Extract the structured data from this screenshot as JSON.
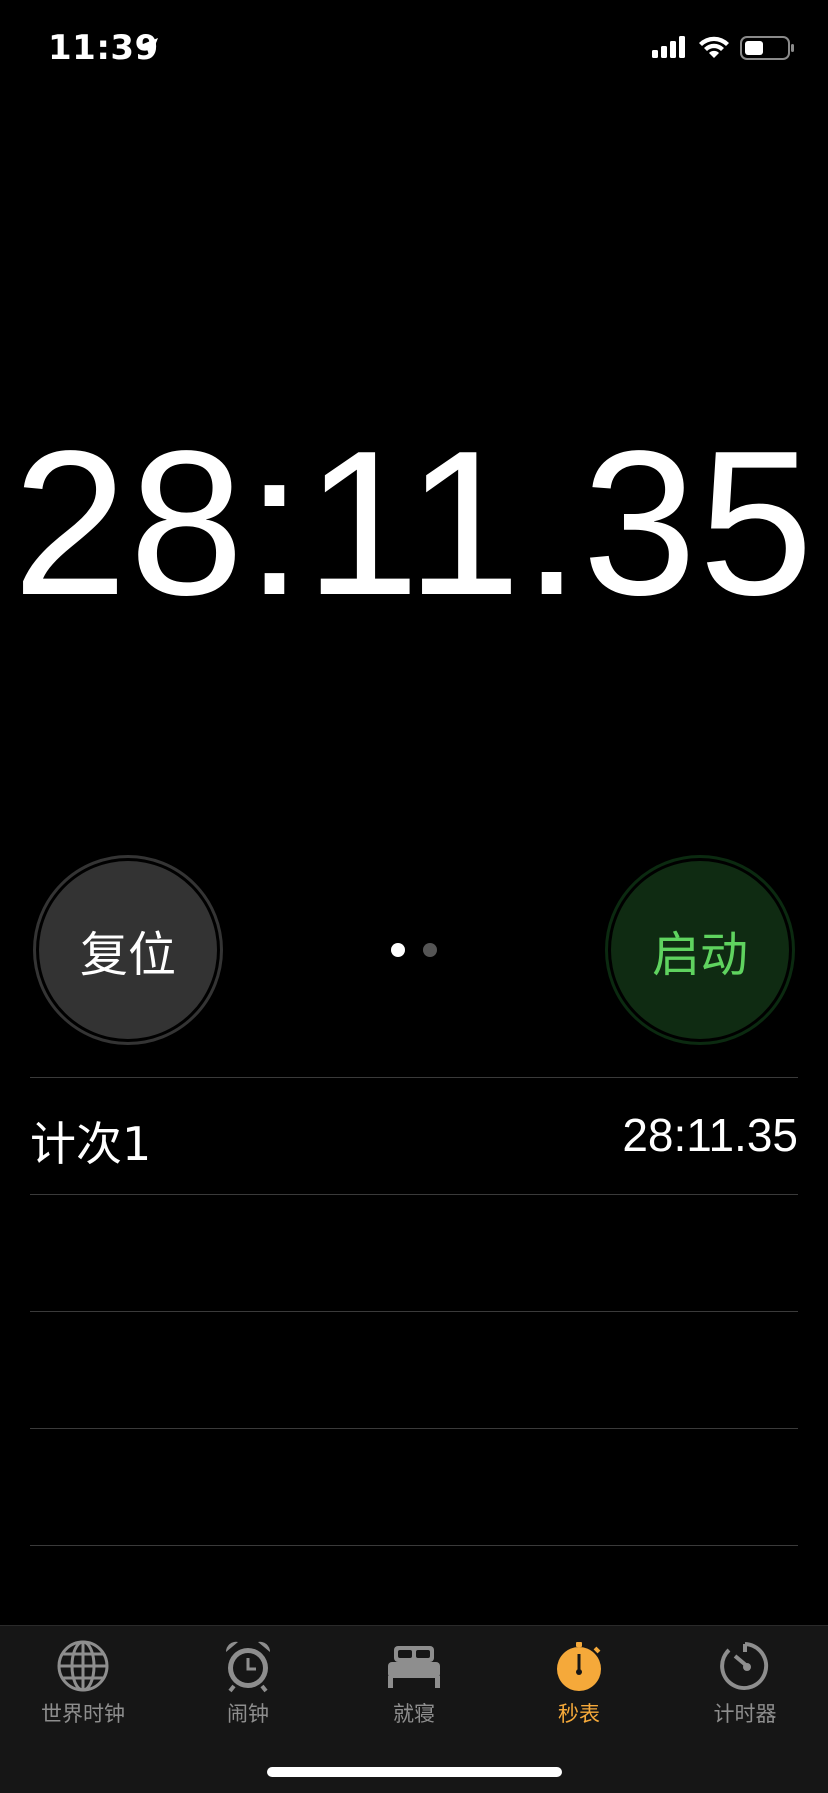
{
  "status_bar": {
    "time": "11:39"
  },
  "stopwatch": {
    "elapsed": "28:11.35",
    "reset_label": "复位",
    "start_label": "启动"
  },
  "laps": [
    {
      "label": "计次1",
      "time": "28:11.35"
    },
    {
      "label": "",
      "time": ""
    },
    {
      "label": "",
      "time": ""
    },
    {
      "label": "",
      "time": ""
    }
  ],
  "tabs": [
    {
      "label": "世界时钟",
      "icon": "globe-icon",
      "active": false
    },
    {
      "label": "闹钟",
      "icon": "alarm-clock-icon",
      "active": false
    },
    {
      "label": "就寝",
      "icon": "bed-icon",
      "active": false
    },
    {
      "label": "秒表",
      "icon": "stopwatch-icon",
      "active": true
    },
    {
      "label": "计时器",
      "icon": "timer-icon",
      "active": false
    }
  ],
  "colors": {
    "accent": "#f5a93a",
    "start_text": "#5fd35f",
    "start_bg": "#0f2b12",
    "reset_bg": "#333333"
  }
}
